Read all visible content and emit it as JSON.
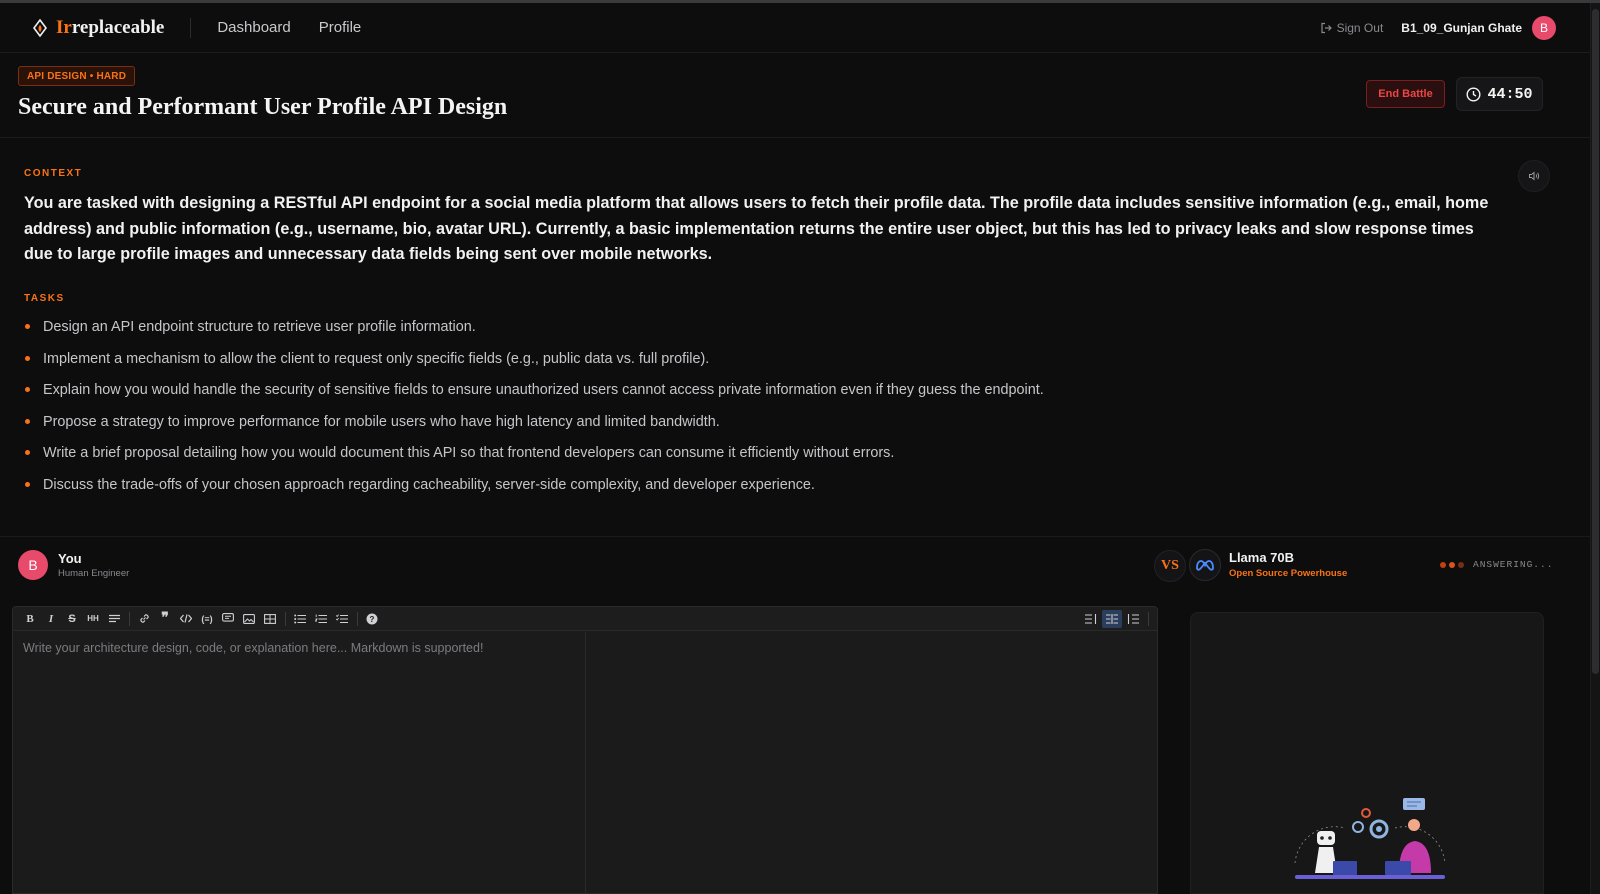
{
  "nav": {
    "brand_accent": "Ir",
    "brand_rest": "replaceable",
    "links": [
      "Dashboard",
      "Profile"
    ],
    "sign_out": "Sign Out",
    "username": "B1_09_Gunjan Ghate",
    "avatar_initial": "B"
  },
  "header": {
    "badge": "API DESIGN • HARD",
    "title": "Secure and Performant User Profile API Design",
    "end_button": "End Battle",
    "timer": "44:50"
  },
  "context": {
    "label": "CONTEXT",
    "text": "You are tasked with designing a RESTful API endpoint for a social media platform that allows users to fetch their profile data. The profile data includes sensitive information (e.g., email, home address) and public information (e.g., username, bio, avatar URL). Currently, a basic implementation returns the entire user object, but this has led to privacy leaks and slow response times due to large profile images and unnecessary data fields being sent over mobile networks."
  },
  "tasks": {
    "label": "TASKS",
    "items": [
      "Design an API endpoint structure to retrieve user profile information.",
      "Implement a mechanism to allow the client to request only specific fields (e.g., public data vs. full profile).",
      "Explain how you would handle the security of sensitive fields to ensure unauthorized users cannot access private information even if they guess the endpoint.",
      "Propose a strategy to improve performance for mobile users who have high latency and limited bandwidth.",
      "Write a brief proposal detailing how you would document this API so that frontend developers can consume it efficiently without errors.",
      "Discuss the trade-offs of your chosen approach regarding cacheability, server-side complexity, and developer experience."
    ]
  },
  "players": {
    "you": {
      "initial": "B",
      "name": "You",
      "subtitle": "Human Engineer"
    },
    "vs": "VS",
    "ai": {
      "name": "Llama 70B",
      "subtitle": "Open Source Powerhouse",
      "status": "ANSWERING..."
    }
  },
  "editor": {
    "placeholder": "Write your architecture design, code, or explanation here... Markdown is supported!",
    "toolbar_icons": [
      "bold-icon",
      "italic-icon",
      "strikethrough-icon",
      "heading-icon",
      "horizontal-rule-icon",
      "link-icon",
      "quote-icon",
      "code-icon",
      "code-block-icon",
      "comment-icon",
      "image-icon",
      "table-icon",
      "unordered-list-icon",
      "ordered-list-icon",
      "checked-list-icon",
      "help-icon"
    ]
  },
  "colors": {
    "accent": "#f97316",
    "danger": "#ef4444",
    "avatar": "#e84a6b",
    "background": "#0d0d0e"
  }
}
